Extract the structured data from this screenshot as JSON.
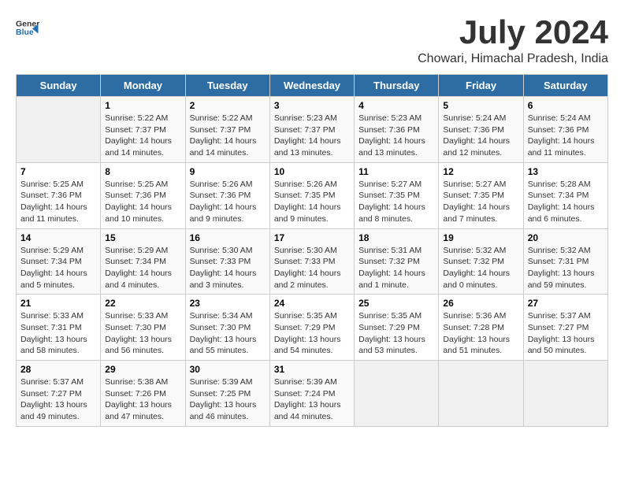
{
  "header": {
    "logo_general": "General",
    "logo_blue": "Blue",
    "month_year": "July 2024",
    "location": "Chowari, Himachal Pradesh, India"
  },
  "weekdays": [
    "Sunday",
    "Monday",
    "Tuesday",
    "Wednesday",
    "Thursday",
    "Friday",
    "Saturday"
  ],
  "weeks": [
    [
      {
        "day": "",
        "info": ""
      },
      {
        "day": "1",
        "info": "Sunrise: 5:22 AM\nSunset: 7:37 PM\nDaylight: 14 hours\nand 14 minutes."
      },
      {
        "day": "2",
        "info": "Sunrise: 5:22 AM\nSunset: 7:37 PM\nDaylight: 14 hours\nand 14 minutes."
      },
      {
        "day": "3",
        "info": "Sunrise: 5:23 AM\nSunset: 7:37 PM\nDaylight: 14 hours\nand 13 minutes."
      },
      {
        "day": "4",
        "info": "Sunrise: 5:23 AM\nSunset: 7:36 PM\nDaylight: 14 hours\nand 13 minutes."
      },
      {
        "day": "5",
        "info": "Sunrise: 5:24 AM\nSunset: 7:36 PM\nDaylight: 14 hours\nand 12 minutes."
      },
      {
        "day": "6",
        "info": "Sunrise: 5:24 AM\nSunset: 7:36 PM\nDaylight: 14 hours\nand 11 minutes."
      }
    ],
    [
      {
        "day": "7",
        "info": "Sunrise: 5:25 AM\nSunset: 7:36 PM\nDaylight: 14 hours\nand 11 minutes."
      },
      {
        "day": "8",
        "info": "Sunrise: 5:25 AM\nSunset: 7:36 PM\nDaylight: 14 hours\nand 10 minutes."
      },
      {
        "day": "9",
        "info": "Sunrise: 5:26 AM\nSunset: 7:36 PM\nDaylight: 14 hours\nand 9 minutes."
      },
      {
        "day": "10",
        "info": "Sunrise: 5:26 AM\nSunset: 7:35 PM\nDaylight: 14 hours\nand 9 minutes."
      },
      {
        "day": "11",
        "info": "Sunrise: 5:27 AM\nSunset: 7:35 PM\nDaylight: 14 hours\nand 8 minutes."
      },
      {
        "day": "12",
        "info": "Sunrise: 5:27 AM\nSunset: 7:35 PM\nDaylight: 14 hours\nand 7 minutes."
      },
      {
        "day": "13",
        "info": "Sunrise: 5:28 AM\nSunset: 7:34 PM\nDaylight: 14 hours\nand 6 minutes."
      }
    ],
    [
      {
        "day": "14",
        "info": "Sunrise: 5:29 AM\nSunset: 7:34 PM\nDaylight: 14 hours\nand 5 minutes."
      },
      {
        "day": "15",
        "info": "Sunrise: 5:29 AM\nSunset: 7:34 PM\nDaylight: 14 hours\nand 4 minutes."
      },
      {
        "day": "16",
        "info": "Sunrise: 5:30 AM\nSunset: 7:33 PM\nDaylight: 14 hours\nand 3 minutes."
      },
      {
        "day": "17",
        "info": "Sunrise: 5:30 AM\nSunset: 7:33 PM\nDaylight: 14 hours\nand 2 minutes."
      },
      {
        "day": "18",
        "info": "Sunrise: 5:31 AM\nSunset: 7:32 PM\nDaylight: 14 hours\nand 1 minute."
      },
      {
        "day": "19",
        "info": "Sunrise: 5:32 AM\nSunset: 7:32 PM\nDaylight: 14 hours\nand 0 minutes."
      },
      {
        "day": "20",
        "info": "Sunrise: 5:32 AM\nSunset: 7:31 PM\nDaylight: 13 hours\nand 59 minutes."
      }
    ],
    [
      {
        "day": "21",
        "info": "Sunrise: 5:33 AM\nSunset: 7:31 PM\nDaylight: 13 hours\nand 58 minutes."
      },
      {
        "day": "22",
        "info": "Sunrise: 5:33 AM\nSunset: 7:30 PM\nDaylight: 13 hours\nand 56 minutes."
      },
      {
        "day": "23",
        "info": "Sunrise: 5:34 AM\nSunset: 7:30 PM\nDaylight: 13 hours\nand 55 minutes."
      },
      {
        "day": "24",
        "info": "Sunrise: 5:35 AM\nSunset: 7:29 PM\nDaylight: 13 hours\nand 54 minutes."
      },
      {
        "day": "25",
        "info": "Sunrise: 5:35 AM\nSunset: 7:29 PM\nDaylight: 13 hours\nand 53 minutes."
      },
      {
        "day": "26",
        "info": "Sunrise: 5:36 AM\nSunset: 7:28 PM\nDaylight: 13 hours\nand 51 minutes."
      },
      {
        "day": "27",
        "info": "Sunrise: 5:37 AM\nSunset: 7:27 PM\nDaylight: 13 hours\nand 50 minutes."
      }
    ],
    [
      {
        "day": "28",
        "info": "Sunrise: 5:37 AM\nSunset: 7:27 PM\nDaylight: 13 hours\nand 49 minutes."
      },
      {
        "day": "29",
        "info": "Sunrise: 5:38 AM\nSunset: 7:26 PM\nDaylight: 13 hours\nand 47 minutes."
      },
      {
        "day": "30",
        "info": "Sunrise: 5:39 AM\nSunset: 7:25 PM\nDaylight: 13 hours\nand 46 minutes."
      },
      {
        "day": "31",
        "info": "Sunrise: 5:39 AM\nSunset: 7:24 PM\nDaylight: 13 hours\nand 44 minutes."
      },
      {
        "day": "",
        "info": ""
      },
      {
        "day": "",
        "info": ""
      },
      {
        "day": "",
        "info": ""
      }
    ]
  ]
}
